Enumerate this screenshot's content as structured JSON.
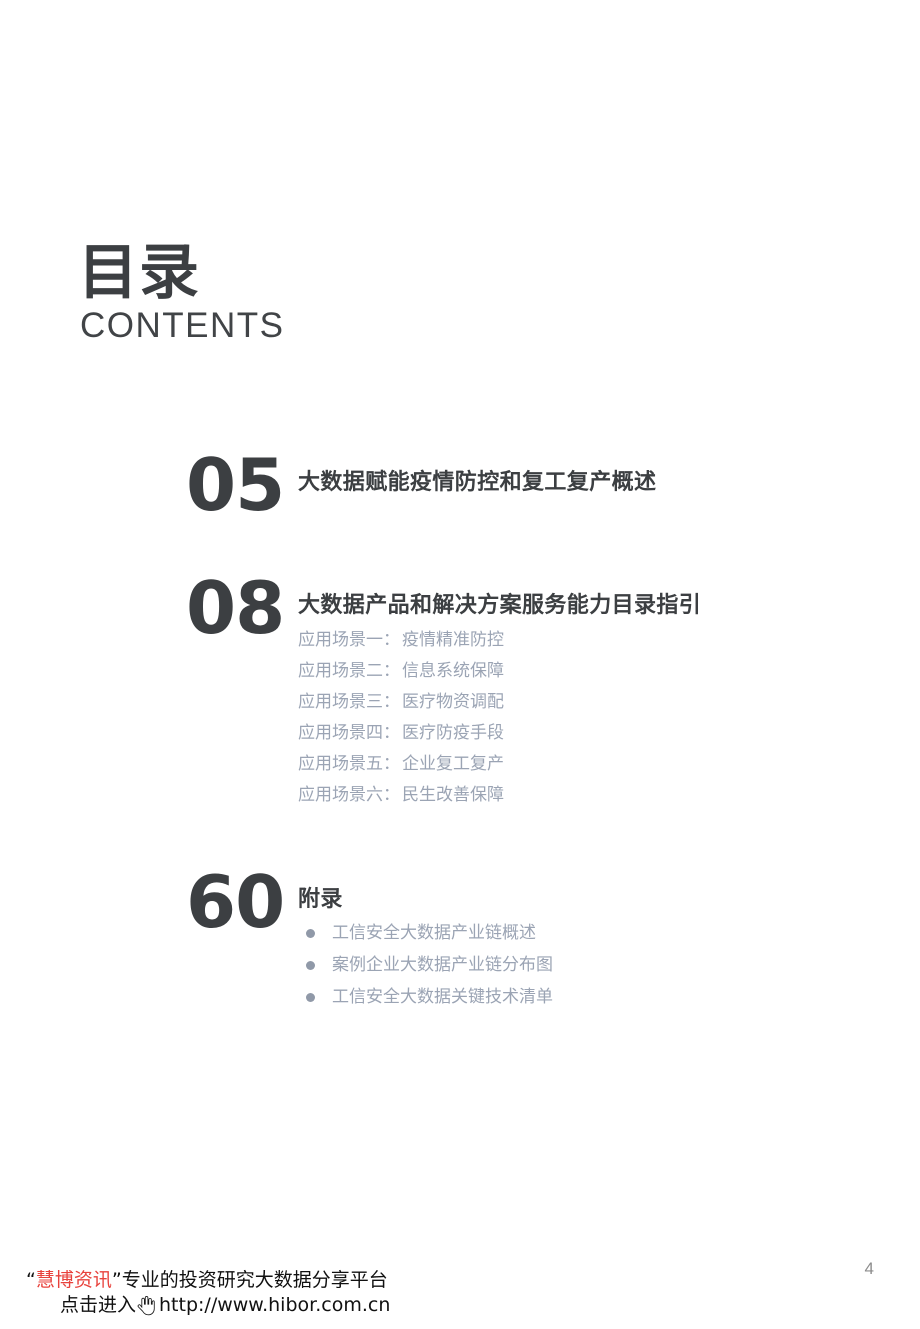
{
  "heading": {
    "title_cn": "目录",
    "title_en": "CONTENTS"
  },
  "entries": [
    {
      "number": "05",
      "title": "大数据赋能疫情防控和复工复产概述",
      "sub_items": [],
      "bullets": []
    },
    {
      "number": "08",
      "title": "大数据产品和解决方案服务能力目录指引",
      "sub_items": [
        {
          "key": "应用场景一：",
          "value": "疫情精准防控"
        },
        {
          "key": "应用场景二：",
          "value": "信息系统保障"
        },
        {
          "key": "应用场景三：",
          "value": "医疗物资调配"
        },
        {
          "key": "应用场景四：",
          "value": "医疗防疫手段"
        },
        {
          "key": "应用场景五：",
          "value": "企业复工复产"
        },
        {
          "key": "应用场景六：",
          "value": "民生改善保障"
        }
      ],
      "bullets": []
    },
    {
      "number": "60",
      "title": "附录",
      "sub_items": [],
      "bullets": [
        "工信安全大数据产业链概述",
        "案例企业大数据产业链分布图",
        "工信安全大数据关键技术清单"
      ]
    }
  ],
  "footer": {
    "brand": "慧博资讯",
    "quote_open": "“",
    "quote_close": "”",
    "tagline": "专业的投资研究大数据分享平台",
    "cta": "点击进入",
    "url": "http://www.hibor.com.cn",
    "hand_icon": "pointing-hand-icon",
    "brand_color": "#e8423c"
  },
  "page_number": "4"
}
